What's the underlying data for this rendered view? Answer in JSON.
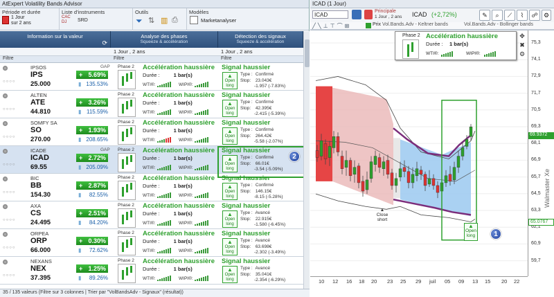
{
  "app_title": "AtExpert Volatility Bands Advisor",
  "ribbon": {
    "period_label": "Période et durée",
    "period_value": "1 Jour",
    "period_sub": "sur 2 ans",
    "instruments_label": "Liste d'instruments",
    "instruments_items": [
      "SRD",
      "CAC",
      "DJ"
    ],
    "tools_label": "Outils",
    "models_label": "Modèles",
    "models_value": "Marketanalyser"
  },
  "columns": [
    {
      "title": "Information sur la valeur",
      "sub": ""
    },
    {
      "title": "Analyse des phases",
      "sub": "Squeeze & accélération"
    },
    {
      "title": "Détection des signaux",
      "sub": "Squeeze & accélération"
    }
  ],
  "period_select": "1 Jour , 2 ans",
  "filter_label": "Filtre",
  "common": {
    "phase_label": "Phase 2",
    "duration_label": "Durée :",
    "duration_value": "1 bar(s)",
    "wti_label": "WTI®:",
    "wipi_label": "WIPI®:",
    "type_label": "Type :",
    "stop_label": "Stop:",
    "signal_btn_top": "Open",
    "signal_btn_bottom": "long",
    "gap_label": "GAP"
  },
  "rows": [
    {
      "name": "IPSOS",
      "symbol": "IPS",
      "price": "25.000",
      "change": "5.69%",
      "pct": "135.53%",
      "gap": true,
      "phase_title": "Accélération haussière",
      "signal_title": "Signal haussier",
      "type": "Confirmé",
      "stop": "23.043€",
      "stop_diff": "-1.957 (-7.83%)"
    },
    {
      "name": "ALTEN",
      "symbol": "ATE",
      "price": "44.810",
      "change": "3.26%",
      "pct": "115.59%",
      "gap": false,
      "phase_title": "Accélération haussière",
      "signal_title": "Signal haussier",
      "type": "Confirmé",
      "stop": "42.395€",
      "stop_diff": "-2.415 (-5.39%)"
    },
    {
      "name": "SOMFY SA",
      "symbol": "SO",
      "price": "270.00",
      "change": "1.93%",
      "pct": "208.65%",
      "gap": false,
      "phase_title": "Accélération haussière",
      "signal_title": "Signal haussier",
      "type": "Confirmé",
      "stop": "264.42€",
      "stop_diff": "-5.58 (-2.07%)"
    },
    {
      "name": "ICADE",
      "symbol": "ICAD",
      "price": "69.55",
      "change": "2.72%",
      "pct": "205.09%",
      "gap": true,
      "phase_title": "Accélération haussière",
      "signal_title": "Signal haussier",
      "type": "Confirmé",
      "stop": "66.01€",
      "stop_diff": "-3.54 (-5.09%)"
    },
    {
      "name": "BIC",
      "symbol": "BB",
      "price": "154.30",
      "change": "2.87%",
      "pct": "82.55%",
      "gap": false,
      "phase_title": "Accélération haussière",
      "signal_title": "Signal haussier",
      "type": "Confirmé",
      "stop": "146.15€",
      "stop_diff": "-8.15 (-5.28%)"
    },
    {
      "name": "AXA",
      "symbol": "CS",
      "price": "24.495",
      "change": "2.51%",
      "pct": "84.20%",
      "gap": false,
      "phase_title": "Accélération haussière",
      "signal_title": "Signal haussier",
      "type": "Avancé",
      "stop": "22.915€",
      "stop_diff": "-1.580 (-6.45%)"
    },
    {
      "name": "ORPEA",
      "symbol": "ORP",
      "price": "66.000",
      "change": "0.30%",
      "pct": "72.62%",
      "gap": false,
      "phase_title": "Accélération haussière",
      "signal_title": "Signal haussier",
      "type": "Avancé",
      "stop": "63.698€",
      "stop_diff": "-2.302 (-3.49%)"
    },
    {
      "name": "NEXANS",
      "symbol": "NEX",
      "price": "37.395",
      "change": "1.25%",
      "pct": "89.26%",
      "gap": false,
      "phase_title": "Accélération haussière",
      "signal_title": "Signal haussier",
      "type": "Avancé",
      "stop": "35.041€",
      "stop_diff": "-2.354 (-6.29%)"
    }
  ],
  "status_text": "35 / 135 valeurs (Filtre sur 3 colonnes | Trier par \"VolBandsAdv - Signaux\" (résultat))",
  "badges": [
    "1",
    "2"
  ],
  "chart_panel": {
    "title": "ICAD (1 Jour)",
    "symbol_input": "ICAD",
    "layout_label": "Principale",
    "layout_sub": "1 Jour , 2 ans",
    "header_symbol": "ICAD",
    "header_change": "(+2,72%)",
    "legend_prix": "Prix",
    "legend_keltner": "Vol.Bands.Adv - Keltner bands",
    "legend_bollinger": "Vol.Bands.Adv - Bollinger bands",
    "watermark": "Walmaster Xe",
    "popup": {
      "phase": "Phase 2",
      "title": "Accélération haussière",
      "duration_label": "Durée :",
      "duration_value": "1 bar(s)",
      "wti": "WTI®:",
      "wipi": "WIPI®:"
    },
    "close_short_top": "Close",
    "close_short_bottom": "short",
    "open_long_top": "Open",
    "open_long_bottom": "long",
    "price_tag_top": "69.9372",
    "price_tag_bottom": "65.0767",
    "y_ticks": [
      "75,3",
      "74,1",
      "72,9",
      "71,7",
      "70,5",
      "69,3",
      "68,1",
      "66,9",
      "65,7",
      "64,5",
      "63,3",
      "62,1",
      "60,9",
      "59,7"
    ],
    "x_ticks": [
      "10",
      "12",
      "16",
      "18",
      "20",
      "23",
      "25",
      "29",
      "juil",
      "05",
      "09",
      "13",
      "15",
      "20",
      "22",
      "24",
      "28"
    ],
    "colors": {
      "red": "#e53b3b",
      "blue": "#9bc9f0",
      "green": "#2ea02e"
    }
  }
}
